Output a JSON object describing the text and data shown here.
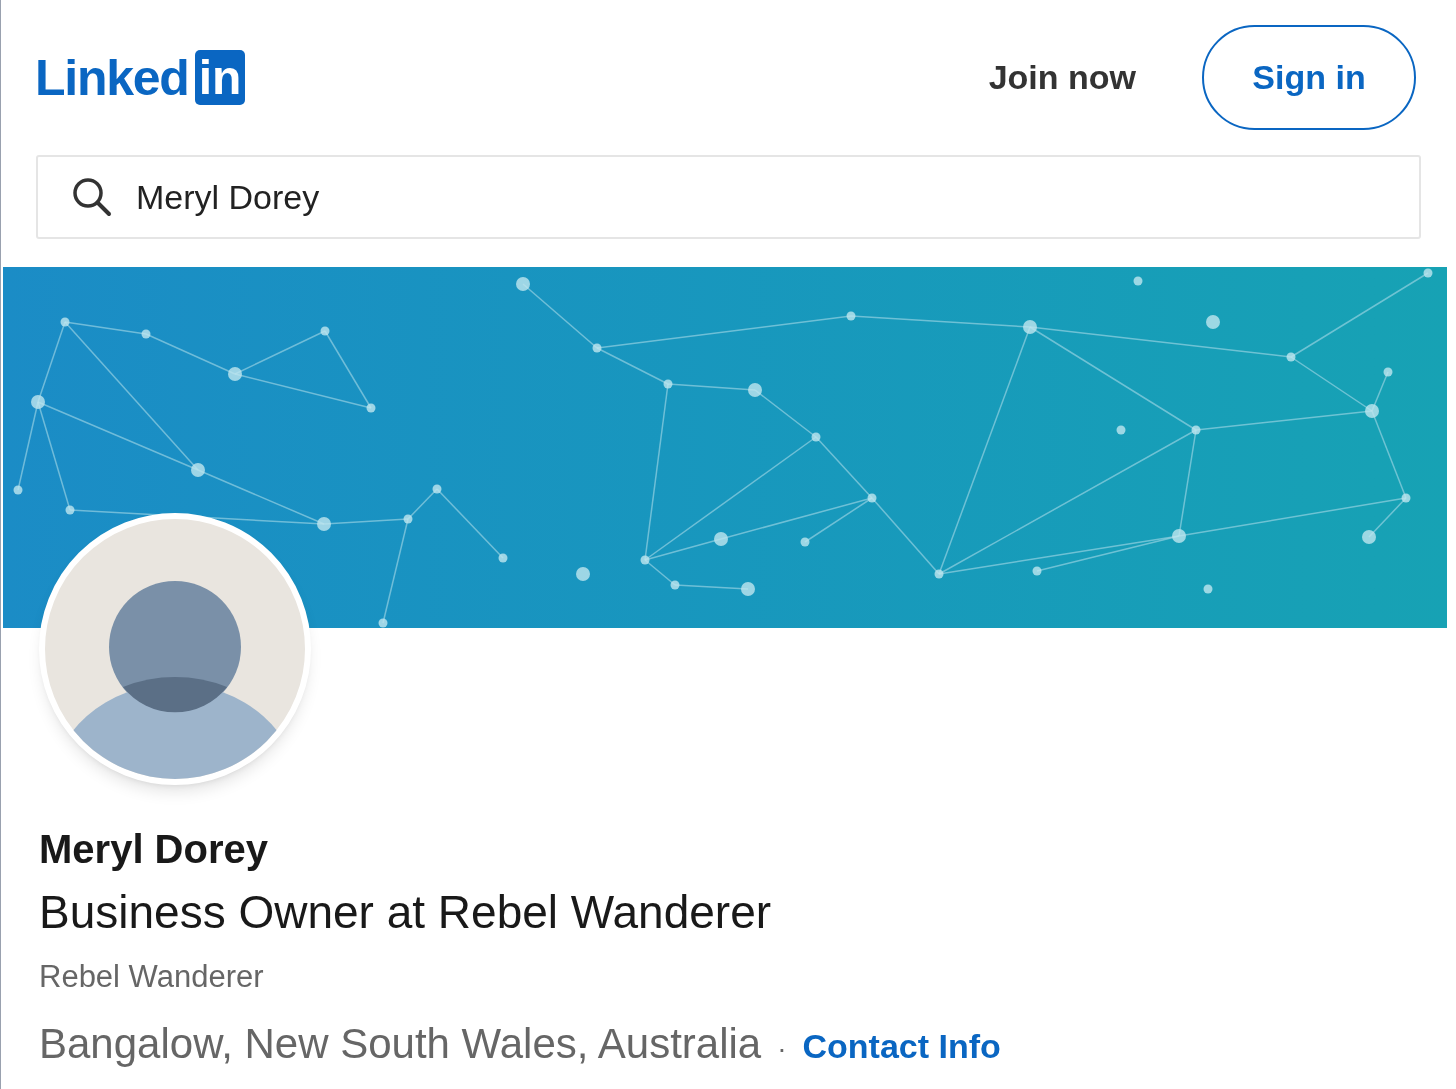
{
  "header": {
    "logo": {
      "word": "Linked",
      "badge": "in"
    },
    "join_link": "Join now",
    "sign_in_button": "Sign in"
  },
  "search": {
    "value": "Meryl Dorey"
  },
  "profile": {
    "name": "Meryl Dorey",
    "headline": "Business Owner at Rebel Wanderer",
    "company": "Rebel Wanderer",
    "location": "Bangalow, New South Wales, Australia",
    "separator": "·",
    "contact_link": "Contact Info"
  }
}
